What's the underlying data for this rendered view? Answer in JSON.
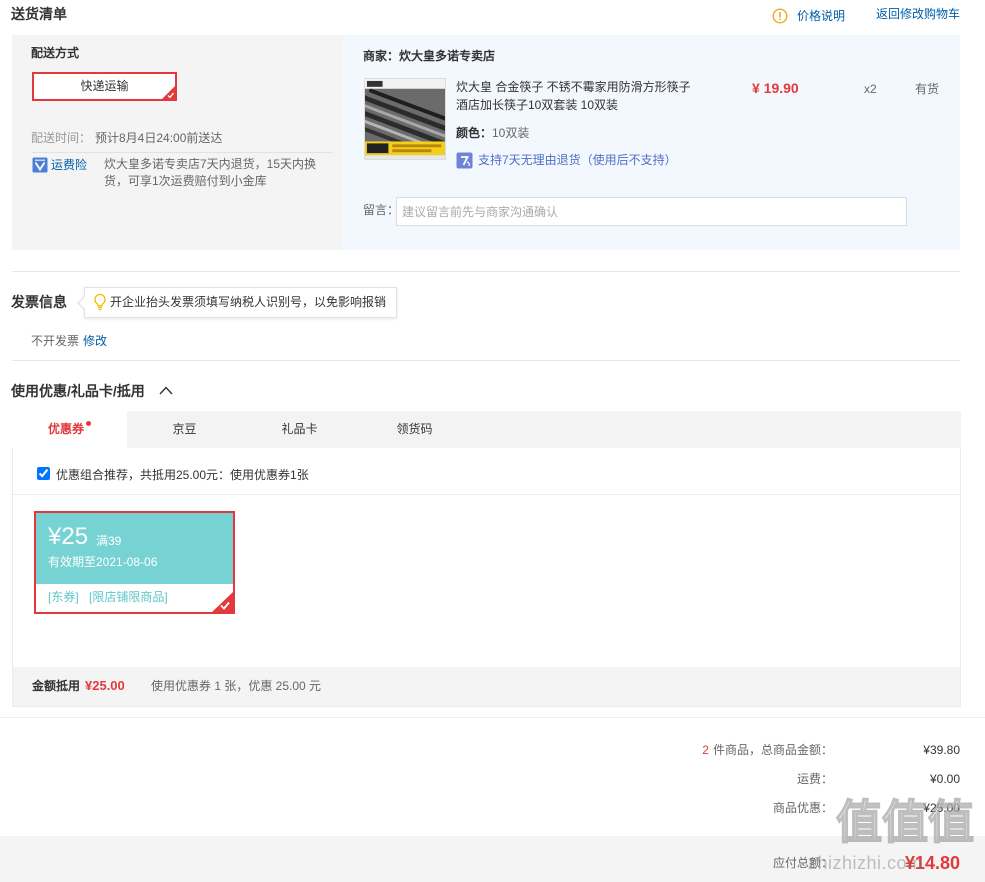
{
  "header": {
    "title": "送货清单",
    "price_info_label": "价格说明",
    "back_to_cart_label": "返回修改购物车"
  },
  "delivery": {
    "section_label": "配送方式",
    "selected_method": "快递运输",
    "time_label": "配送时间：",
    "time_value": "预计8月4日24:00前送达",
    "insurance_label": "运费险",
    "insurance_desc": "炊大皇多诺专卖店7天内退货，15天内换货，可享1次运费赔付到小金库"
  },
  "shop": {
    "label": "商家：炊大皇多诺专卖店",
    "product": {
      "title": "炊大皇 合金筷子 不锈不霉家用防滑方形筷子酒店加长筷子10双套装 10双装",
      "price": "¥ 19.90",
      "quantity": "x2",
      "stock": "有货",
      "color_label": "颜色：",
      "color_value": "10双装",
      "return_policy": "支持7天无理由退货（使用后不支持）"
    },
    "note_label": "留言：",
    "note_placeholder": "建议留言前先与商家沟通确认",
    "note_value": ""
  },
  "invoice": {
    "title": "发票信息",
    "tip": "开企业抬头发票须填写纳税人识别号，以免影响报销",
    "status": "不开发票",
    "edit_label": "修改"
  },
  "discount": {
    "title": "使用优惠/礼品卡/抵用",
    "tabs": [
      {
        "label": "优惠券",
        "active": true
      },
      {
        "label": "京豆",
        "active": false
      },
      {
        "label": "礼品卡",
        "active": false
      },
      {
        "label": "领货码",
        "active": false
      }
    ],
    "combo_recommend": "优惠组合推荐，共抵用25.00元：使用优惠券1张",
    "combo_checked": true,
    "coupon": {
      "amount": "¥25",
      "condition": "满39",
      "expiry": "有效期至2021-08-06",
      "tags": [
        "[东券]",
        "[限店铺限商品]"
      ],
      "selected": true
    },
    "summary": {
      "label": "金额抵用",
      "amount": "¥25.00",
      "desc": "使用优惠券 1 张，优惠 25.00 元"
    }
  },
  "totals": {
    "item_count": "2",
    "item_label": "件商品，总商品金额：",
    "item_amount": "¥39.80",
    "shipping_label": "运费：",
    "shipping_amount": "¥0.00",
    "discount_label": "商品优惠：",
    "discount_amount": "¥25.00",
    "payable_label": "应付总额：",
    "payable_amount": "¥14.80"
  },
  "watermark": {
    "logo": "值值值",
    "site": "zhizhizhi.com"
  },
  "colors": {
    "accent_red": "#e4393c",
    "link_blue": "#005ea7",
    "coupon_teal": "#76d2d3",
    "warning_orange": "#f5a623",
    "bulb_yellow": "#f5b800"
  },
  "icons": {
    "price_info": "info-circle-icon",
    "freight_insurance": "shield-icon",
    "return_policy": "seven-day-return-icon",
    "tip": "lightbulb-icon",
    "collapse": "chevron-up-icon",
    "selected_corner": "check-corner-icon"
  }
}
